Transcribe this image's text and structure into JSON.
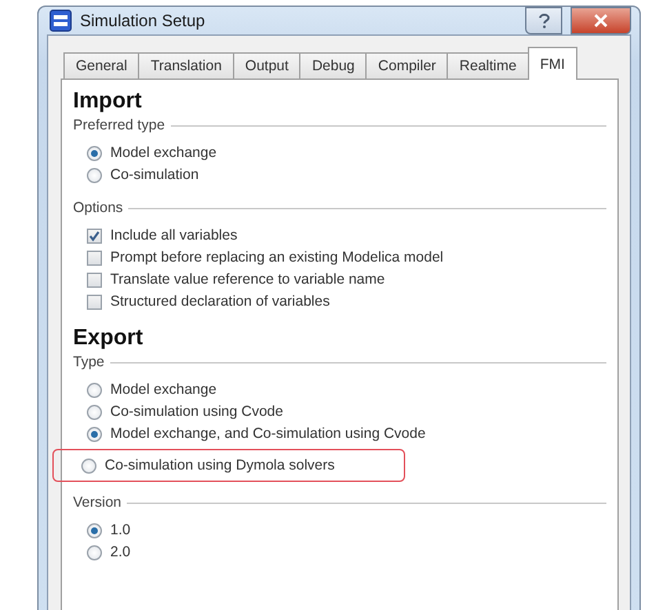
{
  "window": {
    "title": "Simulation Setup"
  },
  "tabs": [
    {
      "label": "General",
      "selected": false
    },
    {
      "label": "Translation",
      "selected": false
    },
    {
      "label": "Output",
      "selected": false
    },
    {
      "label": "Debug",
      "selected": false
    },
    {
      "label": "Compiler",
      "selected": false
    },
    {
      "label": "Realtime",
      "selected": false
    },
    {
      "label": "FMI",
      "selected": true
    }
  ],
  "sections": [
    {
      "heading": "Import",
      "groups": [
        {
          "title": "Preferred type",
          "kind": "radio",
          "options": [
            {
              "label": "Model exchange",
              "selected": true
            },
            {
              "label": "Co-simulation",
              "selected": false
            }
          ]
        },
        {
          "title": "Options",
          "kind": "checkbox",
          "options": [
            {
              "label": "Include all variables",
              "checked": true
            },
            {
              "label": "Prompt before replacing an existing Modelica model",
              "checked": false
            },
            {
              "label": "Translate value reference to variable name",
              "checked": false
            },
            {
              "label": "Structured declaration of variables",
              "checked": false
            }
          ]
        }
      ]
    },
    {
      "heading": "Export",
      "groups": [
        {
          "title": "Type",
          "kind": "radio",
          "options": [
            {
              "label": "Model exchange",
              "selected": false
            },
            {
              "label": "Co-simulation using Cvode",
              "selected": false
            },
            {
              "label": "Model exchange, and Co-simulation using Cvode",
              "selected": true
            },
            {
              "label": "Co-simulation using Dymola solvers",
              "selected": false,
              "highlighted": true
            }
          ]
        },
        {
          "title": "Version",
          "kind": "radio",
          "options": [
            {
              "label": "1.0",
              "selected": true
            },
            {
              "label": "2.0",
              "selected": false
            }
          ]
        }
      ]
    }
  ]
}
